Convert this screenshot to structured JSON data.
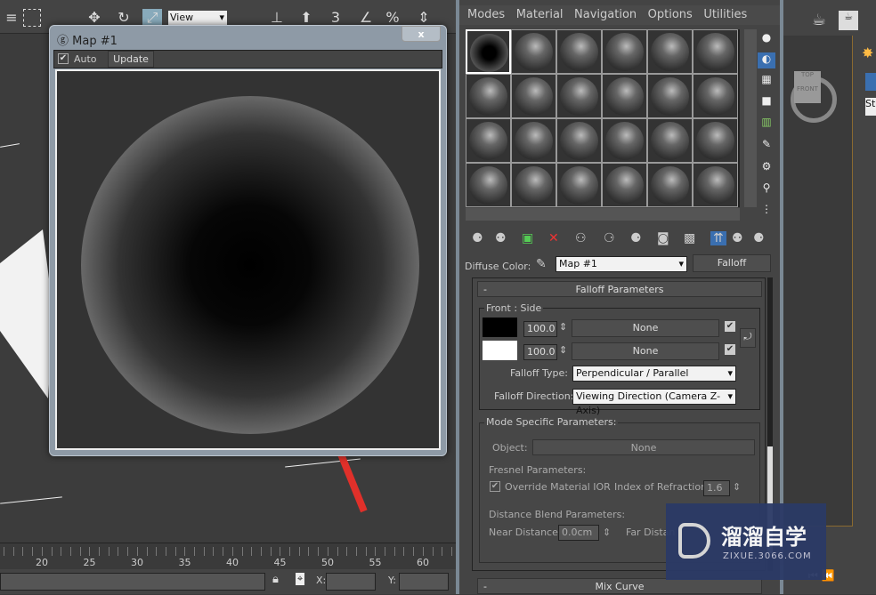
{
  "toolbar": {
    "view_select": "View",
    "snap_label": "3",
    "percent_label": "%"
  },
  "map_window": {
    "title": "Map #1",
    "auto_label": "Auto",
    "auto_checked": true,
    "update_label": "Update"
  },
  "material_editor": {
    "menu": [
      "Modes",
      "Material",
      "Navigation",
      "Options",
      "Utilities"
    ],
    "diffuse_label": "Diffuse Color:",
    "map_name": "Map #1",
    "map_type": "Falloff",
    "falloff": {
      "rollout_title": "Falloff Parameters",
      "collapse": "-",
      "front_side_label": "Front : Side",
      "front_amount": "100.0",
      "front_map": "None",
      "front_color": "#000000",
      "side_amount": "100.0",
      "side_map": "None",
      "side_color": "#ffffff",
      "type_label": "Falloff Type:",
      "type_value": "Perpendicular / Parallel",
      "direction_label": "Falloff Direction:",
      "direction_value": "Viewing Direction (Camera Z-Axis)"
    },
    "mode": {
      "title": "Mode Specific Parameters:",
      "object_label": "Object:",
      "object_value": "None",
      "fresnel_title": "Fresnel Parameters:",
      "override_label": "Override Material IOR",
      "override_checked": true,
      "ior_label": "Index of Refraction",
      "ior_value": "1.6",
      "distance_title": "Distance Blend Parameters:",
      "near_label": "Near Distance:",
      "near_value": "0.0cm",
      "far_label": "Far Distan"
    },
    "mix_curve_title": "Mix Curve"
  },
  "viewcube": {
    "top": "TOP",
    "front": "FRONT"
  },
  "right_panel": {
    "field": "St"
  },
  "timeline": {
    "ticks": [
      "20",
      "25",
      "30",
      "35",
      "40",
      "45",
      "50",
      "55",
      "60"
    ]
  },
  "status": {
    "x_label": "X:",
    "y_label": "Y:"
  },
  "watermark": {
    "name": "溜溜自学",
    "url": "ZIXUE.3066.COM"
  }
}
